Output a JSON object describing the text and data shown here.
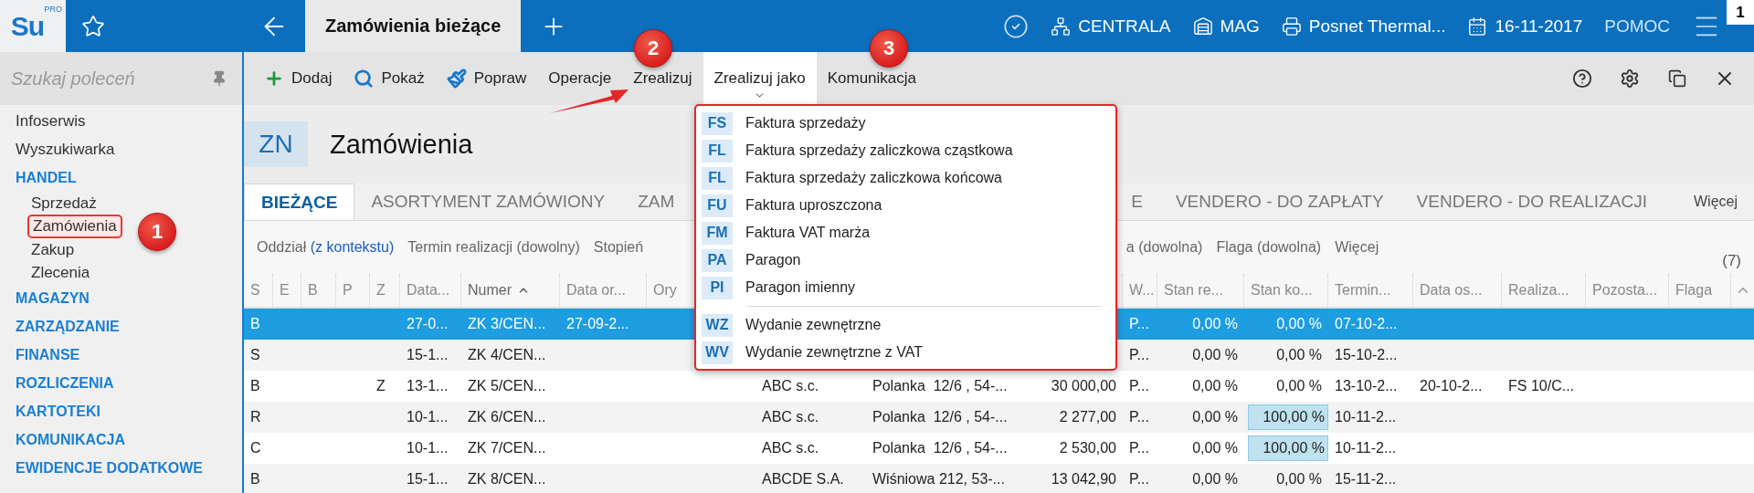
{
  "app_bar": {
    "logo": {
      "text": "Su",
      "badge": "PRO"
    },
    "document_tab": {
      "title": "Zamówienia bieżące",
      "selected": true
    },
    "status_items": [
      {
        "kind": "branch",
        "label": "CENTRALA"
      },
      {
        "kind": "warehouse",
        "label": "MAG"
      },
      {
        "kind": "printer",
        "label": "Posnet Thermal..."
      },
      {
        "kind": "calendar",
        "label": "16-11-2017"
      },
      {
        "kind": "help",
        "label": "POMOC"
      }
    ],
    "notification_count": "1"
  },
  "sidebar": {
    "search": {
      "placeholder": "Szukaj poleceń"
    },
    "items": [
      {
        "kind": "link",
        "label": "Infoserwis",
        "selected": false
      },
      {
        "kind": "link",
        "label": "Wyszukiwarka",
        "selected": false
      },
      {
        "kind": "group",
        "label": "HANDEL",
        "selected": false,
        "children": [
          {
            "label": "Sprzedaż",
            "selected": false
          },
          {
            "label": "Zamówienia",
            "selected": true
          },
          {
            "label": "Zakup",
            "selected": false
          },
          {
            "label": "Zlecenia",
            "selected": false
          }
        ]
      },
      {
        "kind": "group",
        "label": "MAGAZYN",
        "selected": false
      },
      {
        "kind": "group",
        "label": "ZARZĄDZANIE",
        "selected": false
      },
      {
        "kind": "group",
        "label": "FINANSE",
        "selected": false
      },
      {
        "kind": "group",
        "label": "ROZLICZENIA",
        "selected": false
      },
      {
        "kind": "group",
        "label": "KARTOTEKI",
        "selected": false
      },
      {
        "kind": "group",
        "label": "KOMUNIKACJA",
        "selected": false
      },
      {
        "kind": "group",
        "label": "EWIDENCJE DODATKOWE",
        "selected": false
      }
    ]
  },
  "toolbar": {
    "buttons": [
      {
        "kind": "add",
        "label": "Dodaj",
        "open": false
      },
      {
        "kind": "view",
        "label": "Pokaż",
        "open": false
      },
      {
        "kind": "edit",
        "label": "Popraw",
        "open": false
      },
      {
        "kind": "text",
        "label": "Operacje",
        "open": false
      },
      {
        "kind": "text",
        "label": "Zrealizuj",
        "open": false
      },
      {
        "kind": "menu",
        "label": "Zrealizuj jako",
        "open": true
      },
      {
        "kind": "text",
        "label": "Komunikacja",
        "open": false
      }
    ]
  },
  "page_header": {
    "code": "ZN",
    "title": "Zamówienia"
  },
  "tabs": [
    {
      "label": "BIEŻĄCE",
      "selected": true
    },
    {
      "label": "ASORTYMENT ZAMÓWIONY",
      "selected": false
    },
    {
      "label": "ZAM",
      "selected": false
    },
    {
      "label": "E",
      "selected": false
    },
    {
      "label": "VENDERO - DO ZAPŁATY",
      "selected": false
    },
    {
      "label": "VENDERO - DO REALIZACJI",
      "selected": false
    },
    {
      "label": "Więcej",
      "selected": false
    }
  ],
  "filters": [
    {
      "label": "Oddział",
      "value": "(z kontekstu)",
      "set": true
    },
    {
      "label": "Termin realizacji",
      "value": "(dowolny)",
      "set": false
    },
    {
      "label": "Stopień"
    },
    {
      "label": "a (dowolna)"
    },
    {
      "label": "Flaga",
      "value": "(dowolna)",
      "set": false
    },
    {
      "label": "Więcej"
    }
  ],
  "record_count": "(7)",
  "table": {
    "columns": [
      {
        "label": "S",
        "sorted": false
      },
      {
        "label": "E",
        "sorted": false
      },
      {
        "label": "B",
        "sorted": false
      },
      {
        "label": "P",
        "sorted": false
      },
      {
        "label": "Z",
        "sorted": false
      },
      {
        "label": "Data...",
        "sorted": false
      },
      {
        "label": "Numer",
        "sorted": true
      },
      {
        "label": "Data or...",
        "sorted": false
      },
      {
        "label": "Ory",
        "sorted": false
      },
      null,
      null,
      null,
      {
        "label": "W...",
        "sorted": false
      },
      {
        "label": "Stan re...",
        "sorted": false
      },
      {
        "label": "Stan ko...",
        "sorted": false
      },
      {
        "label": "Termin...",
        "sorted": false
      },
      {
        "label": "Data os...",
        "sorted": false
      },
      {
        "label": "Realiza...",
        "sorted": false
      },
      {
        "label": "Pozosta...",
        "sorted": false
      },
      {
        "label": "Flaga",
        "sorted": false
      }
    ],
    "rows": [
      {
        "selected": true,
        "cells": [
          "B",
          null,
          null,
          null,
          null,
          "27-0...",
          "ZK 3/CEN...",
          "27-09-2...",
          null,
          null,
          null,
          null,
          "P...",
          "0,00 %",
          {
            "text": "0,00 %",
            "highlighted": false
          },
          "07-10-2...",
          null,
          null,
          null,
          null
        ]
      },
      {
        "selected": false,
        "cells": [
          "S",
          null,
          null,
          null,
          null,
          "15-1...",
          "ZK 4/CEN...",
          null,
          null,
          null,
          null,
          null,
          "P...",
          "0,00 %",
          {
            "text": "0,00 %",
            "highlighted": false
          },
          "15-10-2...",
          null,
          null,
          null,
          null
        ]
      },
      {
        "selected": false,
        "cells": [
          "B",
          null,
          null,
          null,
          "Z",
          "13-1...",
          "ZK 5/CEN...",
          null,
          null,
          "ABC s.c.",
          "Polanka  12/6 , 54-...",
          "30 000,00",
          "P...",
          "0,00 %",
          {
            "text": "0,00 %",
            "highlighted": false
          },
          "13-10-2...",
          "20-10-2...",
          "FS 10/C...",
          null,
          null
        ]
      },
      {
        "selected": false,
        "cells": [
          "R",
          null,
          null,
          null,
          null,
          "10-1...",
          "ZK 6/CEN...",
          null,
          null,
          "ABC s.c.",
          "Polanka  12/6 , 54-...",
          "2 277,00",
          "P...",
          "0,00 %",
          {
            "text": "100,00 %",
            "highlighted": true
          },
          "10-11-2...",
          null,
          null,
          null,
          null
        ]
      },
      {
        "selected": false,
        "cells": [
          "C",
          null,
          null,
          null,
          null,
          "10-1...",
          "ZK 7/CEN...",
          null,
          null,
          "ABC s.c.",
          "Polanka  12/6 , 54-...",
          "2 530,00",
          "P...",
          "0,00 %",
          {
            "text": "100,00 %",
            "highlighted": true
          },
          "10-11-2...",
          null,
          null,
          null,
          null
        ]
      },
      {
        "selected": false,
        "cells": [
          "B",
          null,
          null,
          null,
          null,
          "15-1...",
          "ZK 8/CEN...",
          null,
          null,
          "ABCDE S.A.",
          "Wiśniowa 212, 53-...",
          "13 042,90",
          "P...",
          "0,00 %",
          {
            "text": "0,00 %",
            "highlighted": false
          },
          "15-11-2...",
          null,
          null,
          null,
          null
        ]
      }
    ]
  },
  "menu": {
    "items": [
      {
        "kind": "item",
        "code": "FS",
        "label": "Faktura sprzedaży"
      },
      {
        "kind": "item",
        "code": "FL",
        "label": "Faktura sprzedaży zaliczkowa cząstkowa"
      },
      {
        "kind": "item",
        "code": "FL",
        "label": "Faktura sprzedaży zaliczkowa końcowa"
      },
      {
        "kind": "item",
        "code": "FU",
        "label": "Faktura uproszczona"
      },
      {
        "kind": "item",
        "code": "FM",
        "label": "Faktura VAT marża"
      },
      {
        "kind": "item",
        "code": "PA",
        "label": "Paragon"
      },
      {
        "kind": "item",
        "code": "PI",
        "label": "Paragon imienny"
      },
      {
        "kind": "separator"
      },
      {
        "kind": "item",
        "code": "WZ",
        "label": "Wydanie zewnętrzne"
      },
      {
        "kind": "item",
        "code": "WV",
        "label": "Wydanie zewnętrzne z VAT"
      }
    ]
  },
  "annotations": [
    {
      "kind": "badge",
      "label": "1"
    },
    {
      "kind": "badge",
      "label": "2"
    },
    {
      "kind": "badge",
      "label": "3"
    },
    {
      "kind": "arrow"
    }
  ]
}
